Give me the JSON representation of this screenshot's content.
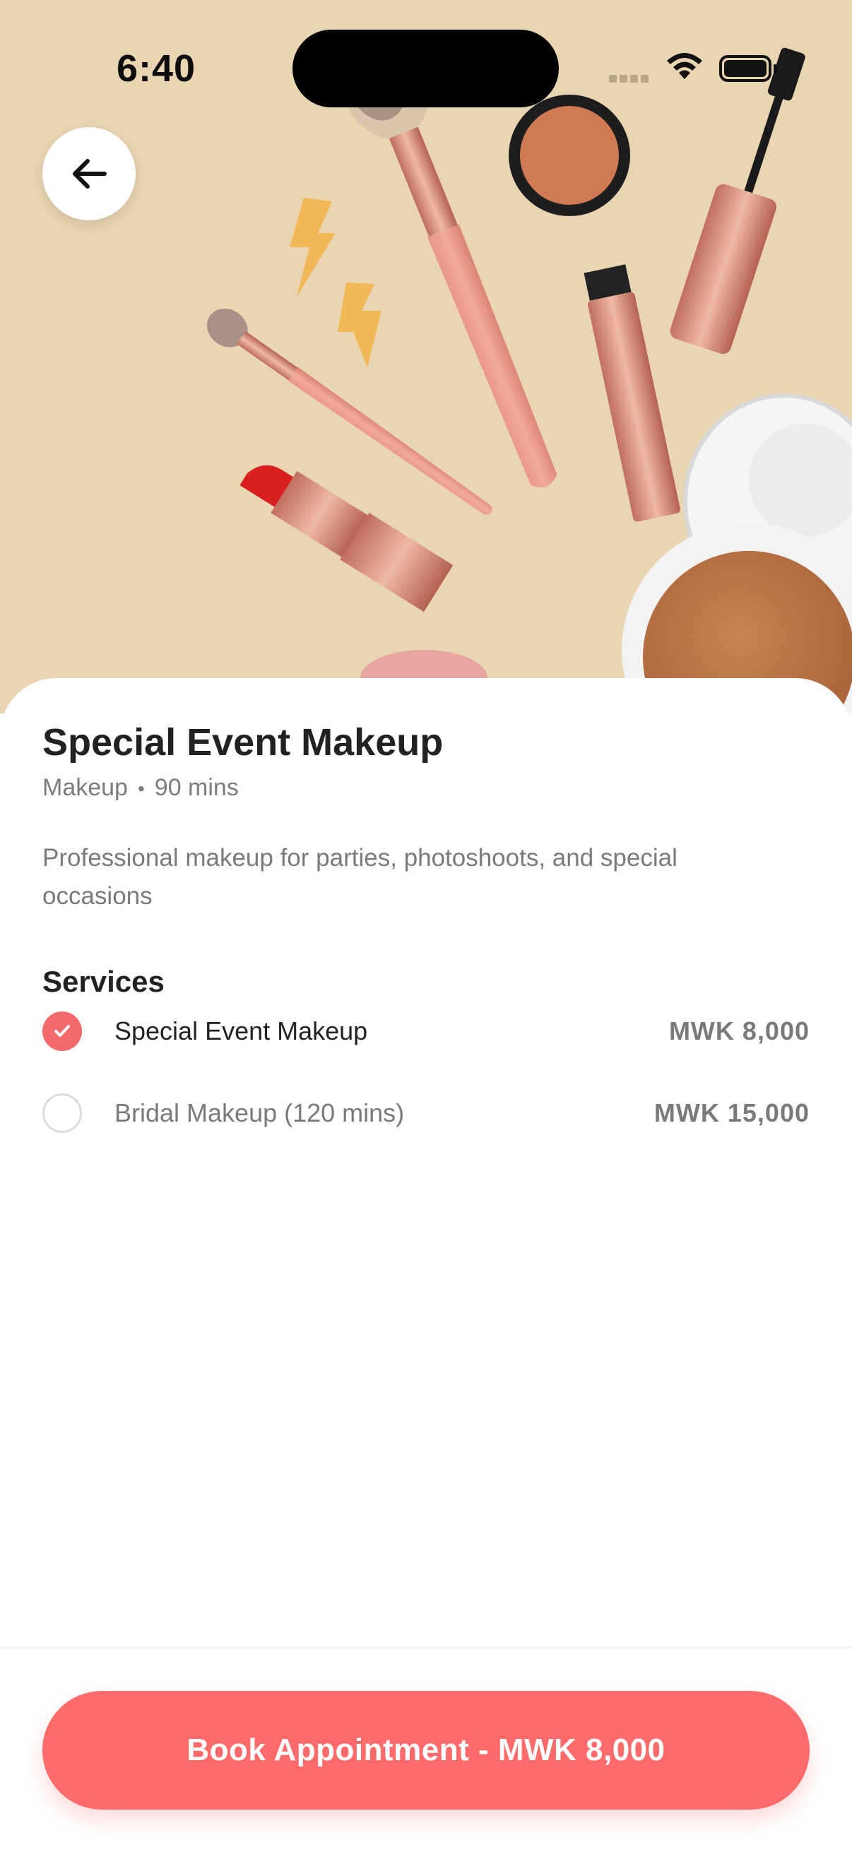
{
  "status_bar": {
    "time": "6:40"
  },
  "hero": {
    "image_subject": "makeup flat-lay (brushes, lipstick, mascara, compact powder)",
    "background_color": "#ead5b3"
  },
  "nav": {
    "back_icon": "arrow-left-icon"
  },
  "service": {
    "title": "Special Event Makeup",
    "category": "Makeup",
    "separator": "•",
    "duration": "90 mins",
    "description": "Professional makeup for parties, photoshoots, and special occasions"
  },
  "services_section": {
    "title": "Services",
    "items": [
      {
        "name": "Special Event Makeup",
        "price": "MWK 8,000",
        "selected": true
      },
      {
        "name": "Bridal Makeup (120 mins)",
        "price": "MWK 15,000",
        "selected": false
      }
    ]
  },
  "footer": {
    "book_label": "Book Appointment - MWK 8,000"
  },
  "colors": {
    "accent": "#ff6b6b",
    "check_selected": "#f36a6c",
    "text_primary": "#222222",
    "text_secondary": "#7a7a7a"
  }
}
